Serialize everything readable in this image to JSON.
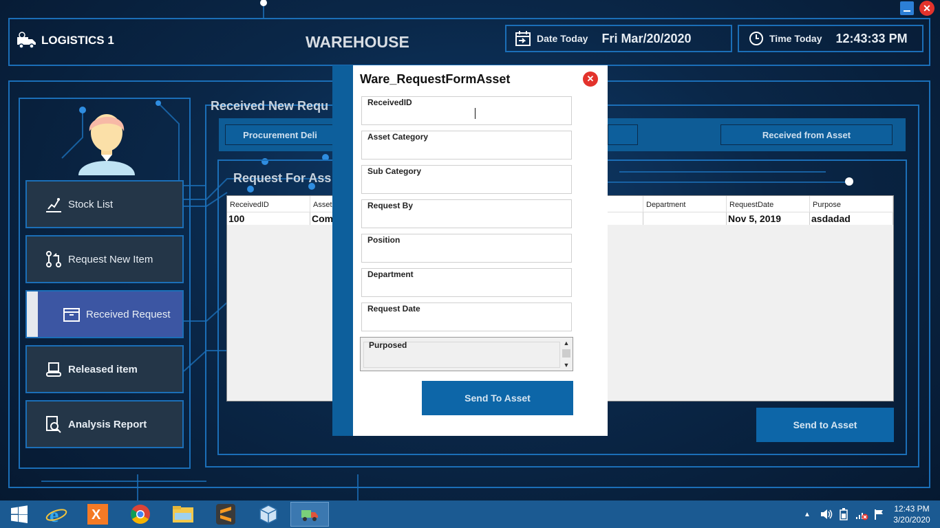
{
  "header": {
    "app_name": "LOGISTICS 1",
    "module_title": "WAREHOUSE",
    "date_label": "Date Today",
    "date_value": "Fri Mar/20/2020",
    "time_label": "Time Today",
    "time_value": "12:43:33 PM"
  },
  "sidebar": {
    "items": [
      {
        "label": "Stock List",
        "icon": "stock-chart-icon"
      },
      {
        "label": "Request New Item",
        "icon": "git-pull-request-icon"
      },
      {
        "label": "Received Request",
        "icon": "box-icon",
        "active": true
      },
      {
        "label": "Released item",
        "icon": "conveyor-icon"
      },
      {
        "label": "Analysis Report",
        "icon": "report-search-icon"
      }
    ]
  },
  "main": {
    "section_title": "Received New Requ",
    "tabs": [
      {
        "label": "Procurement Deli"
      },
      {
        "label": "Received from Asset"
      }
    ],
    "sub_title": "Request For Ass",
    "table": {
      "columns": [
        "ReceivedID",
        "Asset",
        "Department",
        "RequestDate",
        "Purpose"
      ],
      "rows": [
        {
          "ReceivedID": "100",
          "Asset": "Com",
          "Department": "",
          "RequestDate": "Nov 5, 2019",
          "Purpose": "asdadad"
        }
      ]
    },
    "send_button": "Send to Asset"
  },
  "modal": {
    "title": "Ware_RequestFormAsset",
    "close": "✕",
    "fields": [
      {
        "label": "ReceivedID",
        "value": ""
      },
      {
        "label": "Asset Category",
        "value": ""
      },
      {
        "label": "Sub Category",
        "value": ""
      },
      {
        "label": "Request By",
        "value": ""
      },
      {
        "label": "Position",
        "value": ""
      },
      {
        "label": "Department",
        "value": ""
      },
      {
        "label": "Request Date",
        "value": ""
      }
    ],
    "purpose_label": "Purposed",
    "send_button": "Send To Asset"
  },
  "window_controls": {
    "close": "✕"
  },
  "taskbar": {
    "apps": [
      "windows-start-icon",
      "internet-explorer-icon",
      "xampp-icon",
      "chrome-icon",
      "file-explorer-icon",
      "sublime-text-icon",
      "virtualbox-icon",
      "logistics-app-icon"
    ],
    "clock_time": "12:43 PM",
    "clock_date": "3/20/2020"
  },
  "colors": {
    "accent": "#0d66a8",
    "active_nav": "#3c56a3",
    "close_red": "#e3332c"
  }
}
